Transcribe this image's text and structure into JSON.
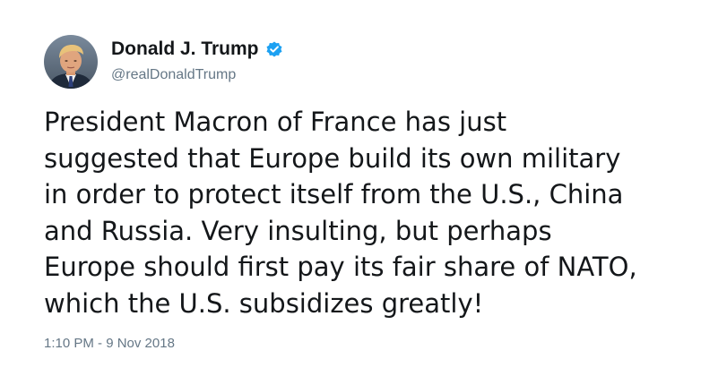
{
  "tweet": {
    "author": {
      "display_name": "Donald J. Trump",
      "handle": "@realDonaldTrump",
      "verified": true,
      "verified_color": "#1da1f2"
    },
    "text": "President Macron of France has just\nsuggested that Europe build its own military\nin order to protect itself from the U.S., China\nand Russia. Very insulting, but perhaps\nEurope should first pay its fair share of NATO,\nwhich the U.S. subsidizes greatly!",
    "timestamp": "1:10 PM - 9 Nov 2018"
  },
  "icons": {
    "verified": "verified-badge-icon",
    "avatar": "profile-photo"
  },
  "colors": {
    "text": "#14171a",
    "secondary": "#657786",
    "accent": "#1da1f2",
    "background": "#ffffff"
  }
}
